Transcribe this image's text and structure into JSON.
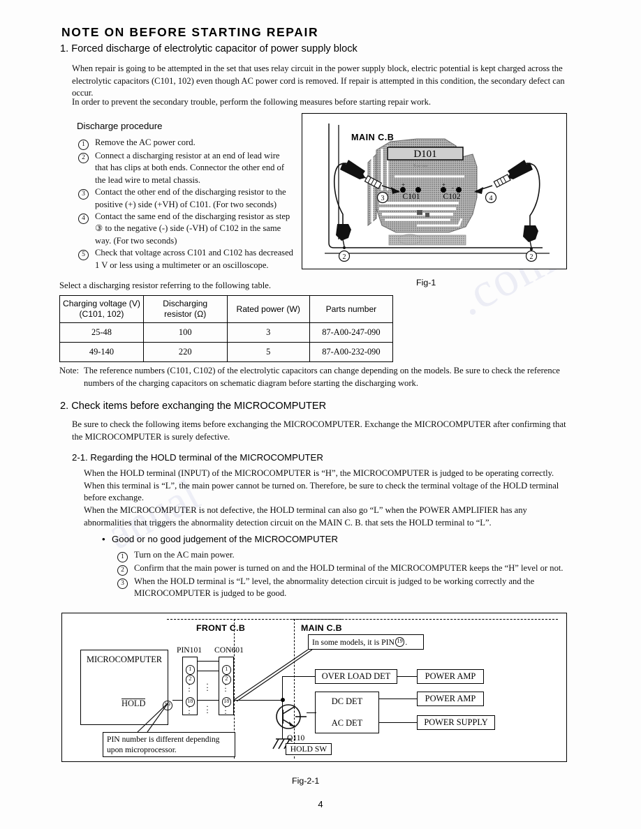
{
  "document": {
    "title": "NOTE ON BEFORE STARTING REPAIR",
    "page_number": "4"
  },
  "section1": {
    "heading": "1. Forced discharge of electrolytic capacitor of power supply block",
    "intro_p1": "When repair is going to be attempted in the set that uses relay circuit in the power supply block, electric potential is kept charged across the electrolytic capacitors (C101, 102) even though AC power cord is removed.  If repair is attempted in this condition, the secondary defect can occur.",
    "intro_p2": "In order to prevent the secondary trouble, perform the following measures before starting repair work.",
    "procedure_heading": "Discharge procedure",
    "steps": [
      {
        "num": "1",
        "text": "Remove the AC power cord."
      },
      {
        "num": "2",
        "text": "Connect a discharging resistor at an end of lead wire that has clips at both ends.  Connector the other end of the lead wire to metal chassis."
      },
      {
        "num": "3",
        "text": "Contact the other end of the discharging resistor to the positive (+) side (+VH) of C101. (For two seconds)"
      },
      {
        "num": "4",
        "text": "Contact the same end of the discharging resistor as step ③ to the negative (-) side (-VH) of C102 in the same way. (For two seconds)"
      },
      {
        "num": "5",
        "text": "Check that voltage across C101 and C102 has decreased 1 V or less using a multimeter or an oscilloscope."
      }
    ],
    "table_intro": "Select a discharging resistor referring to the following table.",
    "note_label": "Note:",
    "note_text": "The reference numbers (C101, C102) of the electrolytic capacitors can change depending on the models.  Be sure to check the reference numbers of the charging capacitors on schematic diagram before starting the discharging work."
  },
  "fig1": {
    "caption": "Fig-1",
    "board_label": "MAIN C.B",
    "diode_label": "D101",
    "cap1_label": "C101",
    "cap2_label": "C102",
    "cap1_plus": "+",
    "cap1_minus": "-",
    "cap2_plus": "+",
    "cap2_minus": "-",
    "callouts": [
      "2",
      "3",
      "4",
      "2"
    ]
  },
  "resistor_table": {
    "headers": [
      "Charging voltage (V)\n(C101, 102)",
      "Discharging\nresistor (Ω)",
      "Rated power (W)",
      "Parts number"
    ],
    "header_lines": [
      [
        "Charging voltage (V)",
        "(C101, 102)"
      ],
      [
        "Discharging",
        "resistor (Ω)"
      ],
      [
        "Rated power (W)",
        ""
      ],
      [
        "Parts number",
        ""
      ]
    ],
    "rows": [
      [
        "25-48",
        "100",
        "3",
        "87-A00-247-090"
      ],
      [
        "49-140",
        "220",
        "5",
        "87-A00-232-090"
      ]
    ]
  },
  "section2": {
    "heading": "2. Check items before exchanging the MICROCOMPUTER",
    "intro": "Be sure to check the following items before exchanging the MICROCOMPUTER.  Exchange the MICROCOMPUTER after confirming that the MICROCOMPUTER is surely defective.",
    "sub_heading": "2-1. Regarding the HOLD terminal of the MICROCOMPUTER",
    "sub_p1": "When the HOLD terminal (INPUT) of the MICROCOMPUTER is “H”, the MICROCOMPUTER is judged to be operating correctly.  When this terminal is “L”, the main power cannot be turned on.  Therefore, be sure to check the terminal voltage of the HOLD terminal before exchange.",
    "sub_p2": "When the MICROCOMPUTER is not defective, the HOLD terminal can also go “L” when the POWER AMPLIFIER has any abnormalities that triggers the abnormality detection circuit on the MAIN C. B. that sets the HOLD terminal to “L”.",
    "bullet_heading": "Good or no good judgement of the MICROCOMPUTER",
    "bullet_steps": [
      {
        "num": "1",
        "text": "Turn on the AC main power."
      },
      {
        "num": "2",
        "text": "Confirm that the main power is turned on and the HOLD terminal of the MICROCOMPUTER keeps the “H” level or not."
      },
      {
        "num": "3",
        "text": "When the HOLD terminal is “L” level, the abnormality detection circuit is judged to be working correctly and the MICROCOMPUTER is judged to be good."
      }
    ]
  },
  "fig2": {
    "caption": "Fig-2-1",
    "front_cb": "FRONT C.B",
    "main_cb": "MAIN C.B",
    "microcomputer": "MICROCOMPUTER",
    "hold_label": "HOLD",
    "hold_pin": "19",
    "pin101": "PIN101",
    "con601": "CON601",
    "pin_numbers": [
      "1",
      "2",
      "18"
    ],
    "pin_note": "PIN number is different depending upon microprocessor.",
    "models_note_pre": "In some models, it is PIN ",
    "models_note_pin": "19",
    "models_note_post": ".",
    "over_load_det": "OVER LOAD DET",
    "power_amp_1": "POWER AMP",
    "dc_det": "DC DET",
    "ac_det": "AC DET",
    "power_amp_2": "POWER AMP",
    "power_supply": "POWER SUPPLY",
    "transistor": "Q110",
    "hold_sw": "HOLD SW"
  },
  "colors": {
    "ink": "#111111",
    "paper": "#fdfdfd",
    "pcb_trace": "#8a8a8a"
  }
}
